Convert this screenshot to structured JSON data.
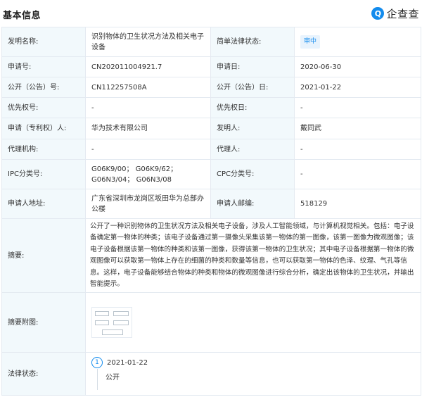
{
  "header": {
    "title": "基本信息",
    "logo_mark": "Q",
    "logo_text": "企查查",
    "logo_icon": "qcc-logo-icon"
  },
  "rows": {
    "invention_name_label": "发明名称:",
    "invention_name_value": "识别物体的卫生状况方法及相关电子设备",
    "legal_status_brief_label": "简单法律状态:",
    "legal_status_brief_value": "审中",
    "application_no_label": "申请号:",
    "application_no_value": "CN202011004921.7",
    "application_date_label": "申请日:",
    "application_date_value": "2020-06-30",
    "publication_no_label": "公开（公告）号:",
    "publication_no_value": "CN112257508A",
    "publication_date_label": "公开（公告）日:",
    "publication_date_value": "2021-01-22",
    "priority_no_label": "优先权号:",
    "priority_no_value": "-",
    "priority_date_label": "优先权日:",
    "priority_date_value": "-",
    "applicant_label": "申请（专利权）人:",
    "applicant_value": "华为技术有限公司",
    "inventor_label": "发明人:",
    "inventor_value": "戴同武",
    "agency_label": "代理机构:",
    "agency_value": "-",
    "agent_label": "代理人:",
    "agent_value": "-",
    "ipc_label": "IPC分类号:",
    "ipc_value": "G06K9/00； G06K9/62； G06N3/04； G06N3/08",
    "cpc_label": "CPC分类号:",
    "cpc_value": "-",
    "address_label": "申请人地址:",
    "address_value": "广东省深圳市龙岗区坂田华为总部办公楼",
    "postcode_label": "申请人邮编:",
    "postcode_value": "518129",
    "abstract_label": "摘要:",
    "abstract_value": "公开了一种识别物体的卫生状况方法及相关电子设备，涉及人工智能领域，与计算机视觉相关。包括：电子设备确定第一物体的种类；该电子设备通过第一摄像头采集该第一物体的第一图像，该第一图像为微观图像；该电子设备根据该第一物体的种类和该第一图像，获得该第一物体的卫生状况；其中电子设备根据第一物体的微观图像可以获取第一物体上存在的细菌的种类和数量等信息，也可以获取第一物体的色泽、纹理、气孔等信息。这样，电子设备能够结合物体的种类和物体的微观图像进行综合分析，确定出该物体的卫生状况，并输出智能提示。",
    "abstract_figure_label": "摘要附图:",
    "law_status_label": "法律状态:"
  },
  "timeline": [
    {
      "index": "1",
      "date": "2021-01-22",
      "event": "公开"
    }
  ],
  "colors": {
    "accent": "#128bed",
    "label_bg": "#f2f9fc",
    "border": "#e4eaf1"
  }
}
